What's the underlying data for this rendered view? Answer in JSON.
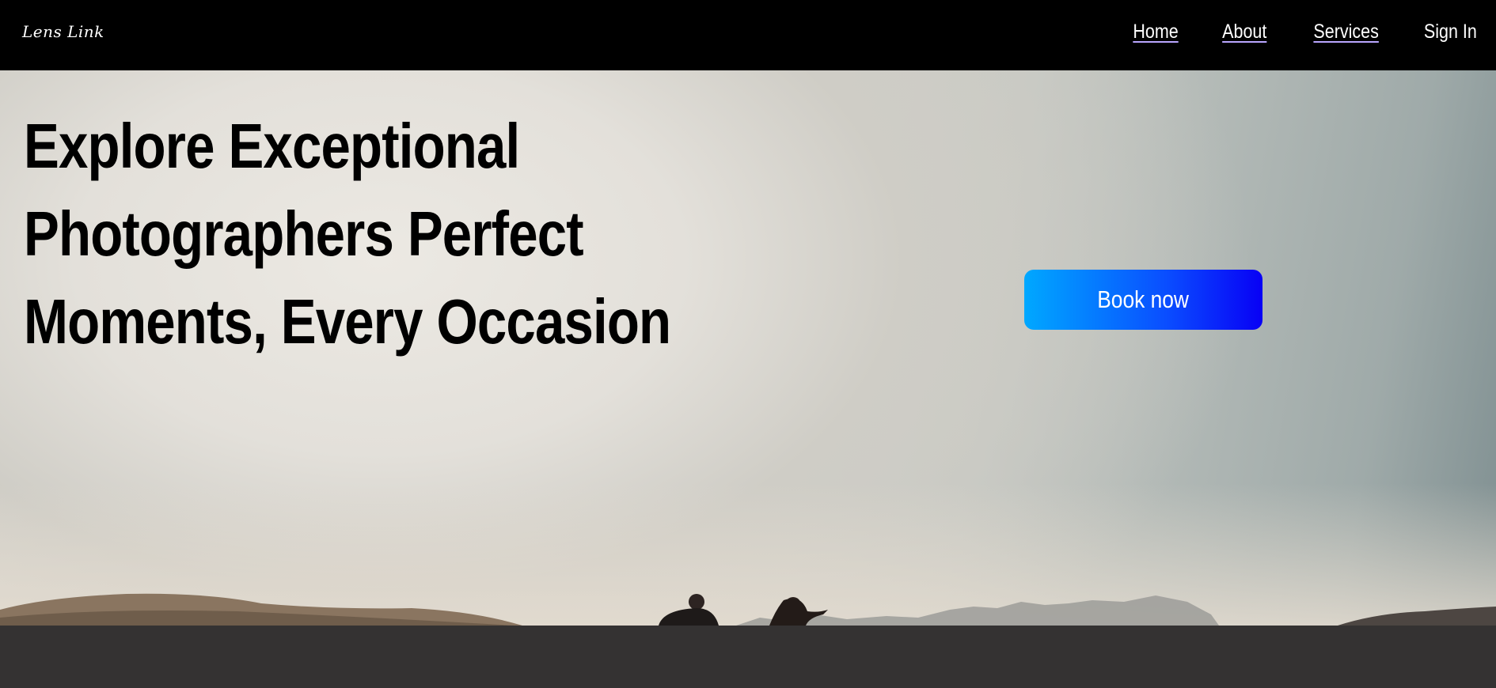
{
  "brand": {
    "logo_text": "Lens Link"
  },
  "nav": {
    "items": [
      {
        "label": "Home"
      },
      {
        "label": "About"
      },
      {
        "label": "Services"
      },
      {
        "label": "Sign In"
      }
    ]
  },
  "hero": {
    "title_lines": [
      "Explore Exceptional",
      "Photographers Perfect",
      "Moments, Every Occasion"
    ],
    "cta_label": "Book now"
  },
  "colors": {
    "navbar_bg": "#000000",
    "cta_gradient_start": "#00a8ff",
    "cta_gradient_end": "#0800f5",
    "bottom_band_bg": "#343232"
  }
}
